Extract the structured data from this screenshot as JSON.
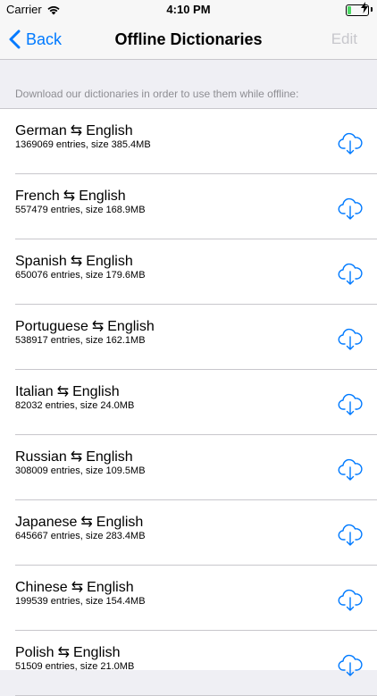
{
  "status_bar": {
    "carrier": "Carrier",
    "time": "4:10 PM"
  },
  "nav": {
    "back_label": "Back",
    "title": "Offline Dictionaries",
    "edit_label": "Edit"
  },
  "section_header": "Download our dictionaries in order to use them while offline:",
  "arrow": "⇆",
  "colors": {
    "accent": "#007aff",
    "disabled": "#c7c7cc",
    "battery": "#4cd964"
  },
  "dictionaries": [
    {
      "language": "German",
      "target": "English",
      "details": "1369069 entries, size 385.4MB"
    },
    {
      "language": "French",
      "target": "English",
      "details": "557479 entries, size 168.9MB"
    },
    {
      "language": "Spanish",
      "target": "English",
      "details": "650076 entries, size 179.6MB"
    },
    {
      "language": "Portuguese",
      "target": "English",
      "details": "538917 entries, size 162.1MB"
    },
    {
      "language": "Italian",
      "target": "English",
      "details": "82032 entries, size 24.0MB"
    },
    {
      "language": "Russian",
      "target": "English",
      "details": "308009 entries, size 109.5MB"
    },
    {
      "language": "Japanese",
      "target": "English",
      "details": "645667 entries, size 283.4MB"
    },
    {
      "language": "Chinese",
      "target": "English",
      "details": "199539 entries, size 154.4MB"
    },
    {
      "language": "Polish",
      "target": "English",
      "details": "51509 entries, size 21.0MB"
    }
  ]
}
